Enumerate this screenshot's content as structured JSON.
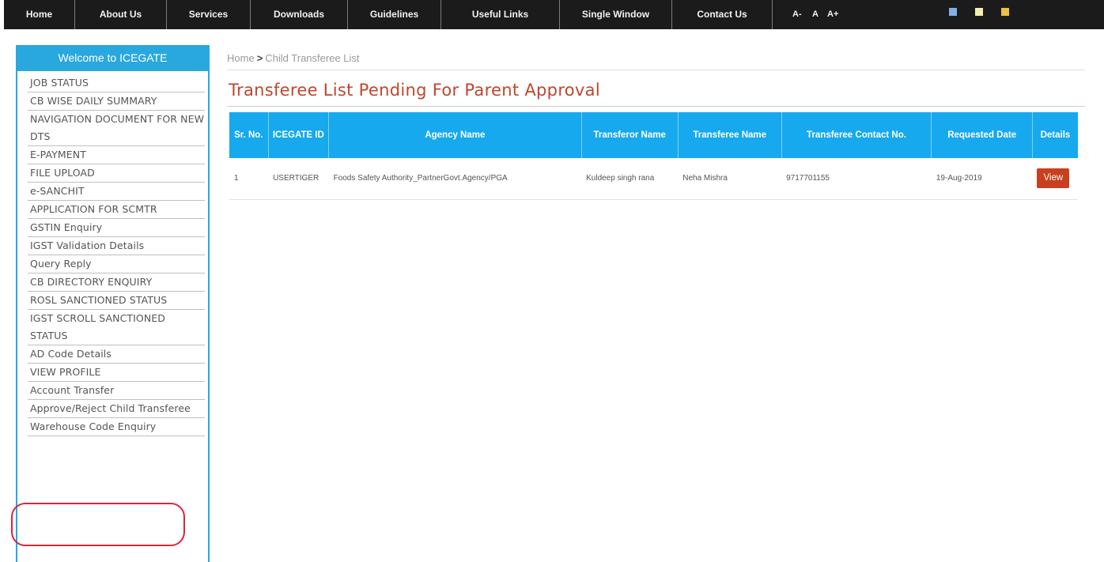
{
  "topnav": {
    "items": [
      "Home",
      "About Us",
      "Services",
      "Downloads",
      "Guidelines",
      "Useful Links",
      "Single Window",
      "Contact Us"
    ],
    "font_sizes": [
      "A-",
      "A",
      "A+"
    ],
    "theme_colors": [
      "#7fb0e8",
      "#f3efb0",
      "#f0c040"
    ]
  },
  "sidebar": {
    "title": "Welcome to ICEGATE",
    "items": [
      "JOB STATUS",
      "CB WISE DAILY SUMMARY",
      "NAVIGATION DOCUMENT FOR NEW DTS",
      "E-PAYMENT",
      "FILE UPLOAD",
      "e-SANCHIT",
      "APPLICATION FOR SCMTR",
      "GSTIN Enquiry",
      "IGST Validation Details",
      "Query Reply",
      "CB DIRECTORY ENQUIRY",
      "ROSL SANCTIONED STATUS",
      "IGST SCROLL SANCTIONED STATUS",
      "AD Code Details",
      "VIEW PROFILE",
      "Account Transfer",
      "Approve/Reject Child Transferee",
      "Warehouse Code Enquiry"
    ]
  },
  "breadcrumb": {
    "home": "Home",
    "separator": ">",
    "current": "Child Transferee List"
  },
  "page": {
    "title": "Transferee List Pending For Parent Approval"
  },
  "table": {
    "headers": [
      "Sr. No.",
      "ICEGATE ID",
      "Agency Name",
      "Transferor Name",
      "Transferee Name",
      "Transferee Contact No.",
      "Requested Date",
      "Details"
    ],
    "rows": [
      {
        "sr": "1",
        "icegate_id": "USERTIGER",
        "agency": "Foods Safety Authority_PartnerGovt.Agency/PGA",
        "transferor": "Kuldeep singh rana",
        "transferee": "Neha Mishra",
        "contact": "9717701155",
        "date": "19-Aug-2019",
        "action": "View"
      }
    ]
  },
  "colors": {
    "accent_blue": "#16a9ee",
    "title_red": "#c0462d",
    "button_red": "#c8401f",
    "annotation_red": "#d9273a"
  }
}
